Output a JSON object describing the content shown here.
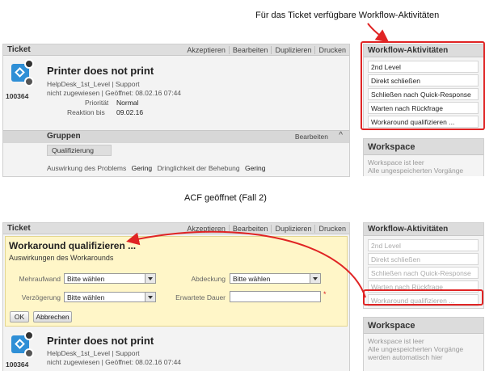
{
  "captions": {
    "top": "Für das Ticket verfügbare Workflow-Aktivitäten",
    "middle": "ACF geöffnet (Fall 2)"
  },
  "ticket": {
    "panel_title": "Ticket",
    "toolbar": [
      "Akzeptieren",
      "Bearbeiten",
      "Duplizieren",
      "Drucken"
    ],
    "title": "Printer does not print",
    "id": "100364",
    "line1": "HelpDesk_1st_Level | Support",
    "line2": "nicht zugewiesen | Geöffnet: 08.02.16 07:44",
    "prio_label": "Priorität",
    "prio_value": "Normal",
    "reaction_label": "Reaktion bis",
    "reaction_value": "09.02.16"
  },
  "groups": {
    "title": "Gruppen",
    "edit": "Bearbeiten",
    "tag": "Qualifizierung",
    "impact_label": "Auswirkung des Problems",
    "impact_value": "Gering",
    "urgency_label": "Dringlichkeit der Behebung",
    "urgency_value": "Gering"
  },
  "workflow": {
    "title": "Workflow-Aktivitäten",
    "items": [
      "2nd Level",
      "Direkt schließen",
      "Schließen nach Quick-Response",
      "Warten nach Rückfrage",
      "Workaround qualifizieren ..."
    ]
  },
  "workspace": {
    "title": "Workspace",
    "lines_top": [
      "Workspace ist leer",
      "Alle ungespeicherten Vorgänge"
    ],
    "lines_bottom": [
      "Workspace ist leer",
      "Alle ungespeicherten Vorgänge",
      "werden automatisch hier"
    ]
  },
  "acf": {
    "title": "Workaround qualifizieren ...",
    "subtitle": "Auswirkungen des Workarounds",
    "f1_label": "Mehraufwand",
    "f1_value": "Bitte wählen",
    "f2_label": "Abdeckung",
    "f2_value": "Bitte wählen",
    "f3_label": "Verzögerung",
    "f3_value": "Bitte wählen",
    "f4_label": "Erwartete Dauer",
    "f4_value": "",
    "required_mark": "*",
    "ok": "OK",
    "cancel": "Abbrechen"
  },
  "colors": {
    "annotation_red": "#e02424",
    "ticket_icon": "#2f8fd6",
    "acf_bg": "#fff6c8"
  }
}
